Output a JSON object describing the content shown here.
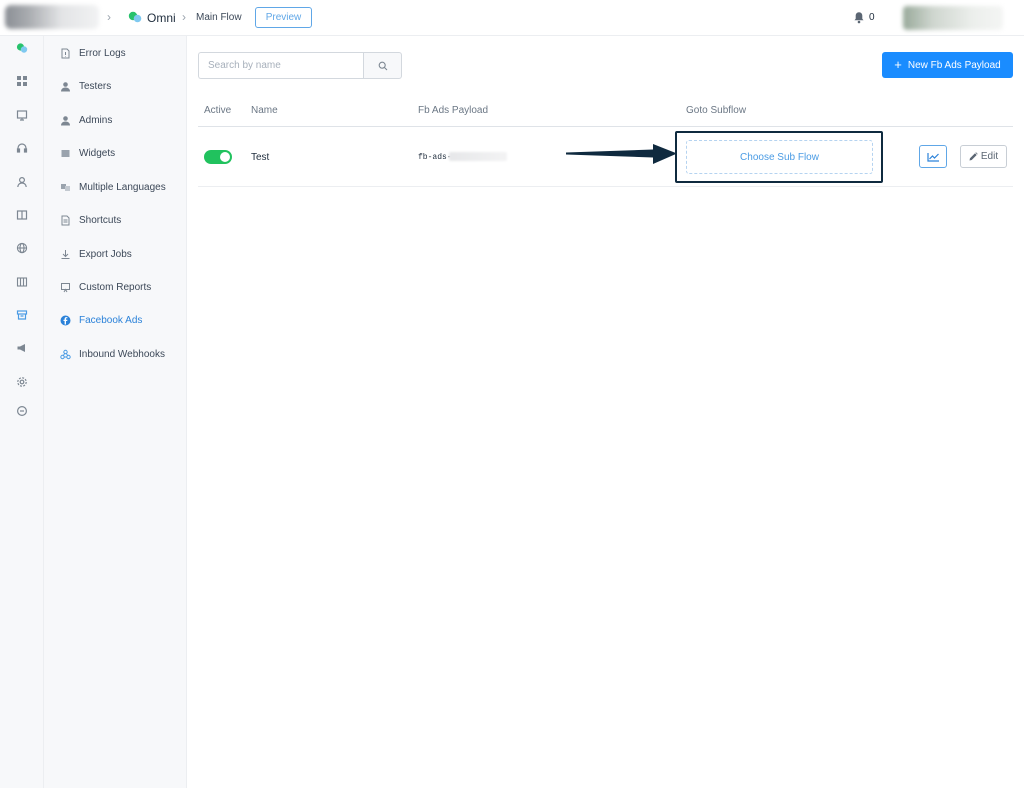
{
  "topbar": {
    "breadcrumb": [
      {
        "label": "Omni",
        "icon": "chat-bubbles-icon"
      },
      {
        "label": "Main Flow"
      }
    ],
    "preview_label": "Preview",
    "notifications_count": "0"
  },
  "rail": {
    "icons": [
      "chat-bubbles-icon",
      "dashboard-icon",
      "inbox-icon",
      "headset-icon",
      "user-icon",
      "book-icon",
      "globe-icon",
      "table-icon",
      "archive-icon",
      "megaphone-icon",
      "settings-icon",
      "chat-icon"
    ]
  },
  "sidebar": {
    "items": [
      {
        "label": "Error Logs",
        "icon": "file-alert-icon"
      },
      {
        "label": "Testers",
        "icon": "user-icon"
      },
      {
        "label": "Admins",
        "icon": "user-icon"
      },
      {
        "label": "Widgets",
        "icon": "widget-icon"
      },
      {
        "label": "Multiple Languages",
        "icon": "translate-icon"
      },
      {
        "label": "Shortcuts",
        "icon": "document-icon"
      },
      {
        "label": "Export Jobs",
        "icon": "download-icon"
      },
      {
        "label": "Custom Reports",
        "icon": "report-icon"
      },
      {
        "label": "Facebook Ads",
        "icon": "facebook-icon",
        "active": true
      },
      {
        "label": "Inbound Webhooks",
        "icon": "webhook-icon"
      }
    ]
  },
  "search": {
    "placeholder": "Search by name",
    "value": ""
  },
  "new_button_label": "New Fb Ads Payload",
  "table": {
    "columns": [
      "Active",
      "Name",
      "Fb Ads Payload",
      "Goto Subflow"
    ],
    "rows": [
      {
        "active": true,
        "name": "Test",
        "payload": "fb-ads-",
        "subflow_label": "Choose Sub Flow",
        "edit_label": "Edit"
      }
    ]
  },
  "colors": {
    "primary": "#1a8cff",
    "toggle_on": "#21c25e",
    "link_active": "#2b82d9",
    "annotation": "#0f2a3f"
  }
}
